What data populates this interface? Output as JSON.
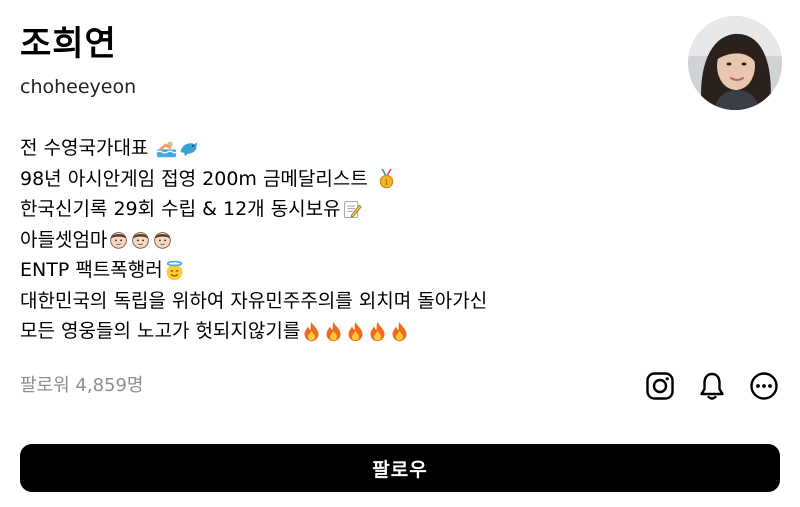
{
  "profile": {
    "name": "조희연",
    "username": "choheeyeon"
  },
  "bio": {
    "lines": [
      "전 수영국가대표",
      "98년 아시안게임 접영 200m 금메달리스트",
      "한국신기록 29회 수립 & 12개 동시보유",
      "아들셋엄마",
      "ENTP 팩트폭행러",
      "대한민국의 독립을 위하여 자유민주주의를 외치며 돌아가신",
      "모든 영웅들의 노고가 헛되지않기를"
    ],
    "emoji": {
      "line1": [
        "swimmer-emoji",
        "dolphin-emoji"
      ],
      "line2": [
        "gold-medal-emoji"
      ],
      "line3": [
        "memo-emoji"
      ],
      "line4": [
        "boy-face-emoji",
        "boy-face-emoji",
        "boy-face-emoji"
      ],
      "line5": [
        "halo-smile-emoji"
      ],
      "line7": [
        "fire-emoji",
        "fire-emoji",
        "fire-emoji",
        "fire-emoji",
        "fire-emoji"
      ]
    }
  },
  "stats": {
    "followers": "팔로워 4,859명"
  },
  "actions": {
    "icons": [
      "instagram-icon",
      "bell-icon",
      "more-options-icon"
    ],
    "follow_label": "팔로우"
  },
  "colors": {
    "button_bg": "#000000",
    "button_text": "#ffffff",
    "muted_text": "#8e8e8e"
  }
}
